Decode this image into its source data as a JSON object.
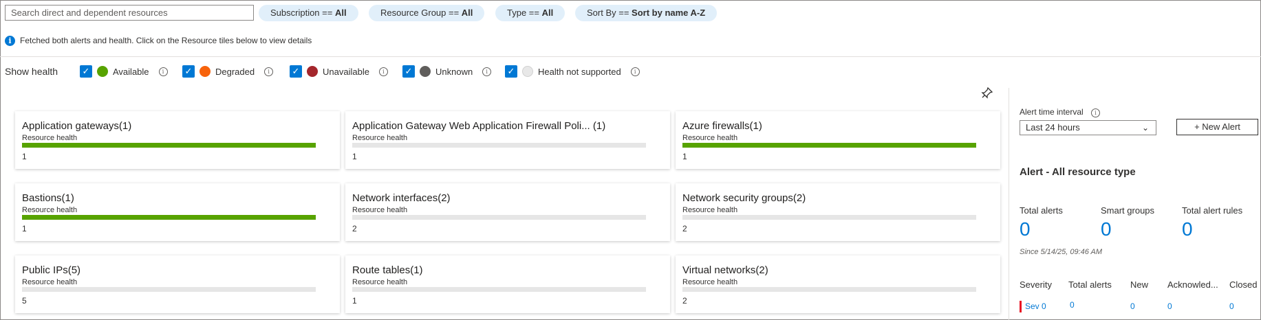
{
  "filters": {
    "search_placeholder": "Search direct and dependent resources",
    "pills": [
      {
        "key": "Subscription == ",
        "value": "All"
      },
      {
        "key": "Resource Group == ",
        "value": "All"
      },
      {
        "key": "Type == ",
        "value": "All"
      },
      {
        "key": "Sort By == ",
        "value": "Sort by name A-Z"
      }
    ]
  },
  "info_message": "Fetched both alerts and health. Click on the Resource tiles below to view details",
  "health": {
    "label": "Show health",
    "items": [
      {
        "label": "Available",
        "color": "#57a300",
        "checked": true
      },
      {
        "label": "Degraded",
        "color": "#f7630c",
        "checked": true
      },
      {
        "label": "Unavailable",
        "color": "#a4262c",
        "checked": true
      },
      {
        "label": "Unknown",
        "color": "#605e5c",
        "checked": true
      },
      {
        "label": "Health not supported",
        "color": "#e8e8e8",
        "checked": true
      }
    ]
  },
  "tiles": [
    {
      "title": "Application gateways(1)",
      "subtitle": "Resource health",
      "count": "1",
      "health_fraction": 1.0
    },
    {
      "title": "Application Gateway Web Application Firewall Poli...  (1)",
      "subtitle": "Resource health",
      "count": "1",
      "health_fraction": 0
    },
    {
      "title": "Azure firewalls(1)",
      "subtitle": "Resource health",
      "count": "1",
      "health_fraction": 1.0
    },
    {
      "title": "Bastions(1)",
      "subtitle": "Resource health",
      "count": "1",
      "health_fraction": 1.0
    },
    {
      "title": "Network interfaces(2)",
      "subtitle": "Resource health",
      "count": "2",
      "health_fraction": 0
    },
    {
      "title": "Network security groups(2)",
      "subtitle": "Resource health",
      "count": "2",
      "health_fraction": 0
    },
    {
      "title": "Public IPs(5)",
      "subtitle": "Resource health",
      "count": "5",
      "health_fraction": 0
    },
    {
      "title": "Route tables(1)",
      "subtitle": "Resource health",
      "count": "1",
      "health_fraction": 0
    },
    {
      "title": "Virtual networks(2)",
      "subtitle": "Resource health",
      "count": "2",
      "health_fraction": 0
    }
  ],
  "alerts": {
    "interval_label": "Alert time interval",
    "interval_value": "Last 24 hours",
    "new_alert_label": "New Alert",
    "heading": "Alert - All resource type",
    "stats": [
      {
        "label": "Total alerts",
        "value": "0"
      },
      {
        "label": "Smart groups",
        "value": "0"
      },
      {
        "label": "Total alert rules",
        "value": "0"
      }
    ],
    "since": "Since 5/14/25, 09:46 AM",
    "table": {
      "headers": [
        "Severity",
        "Total alerts",
        "New",
        "Acknowled...",
        "Closed"
      ],
      "rows": [
        {
          "severity": "Sev 0",
          "total": "0",
          "new": "0",
          "acknowledged": "0",
          "closed": "0"
        }
      ]
    }
  }
}
